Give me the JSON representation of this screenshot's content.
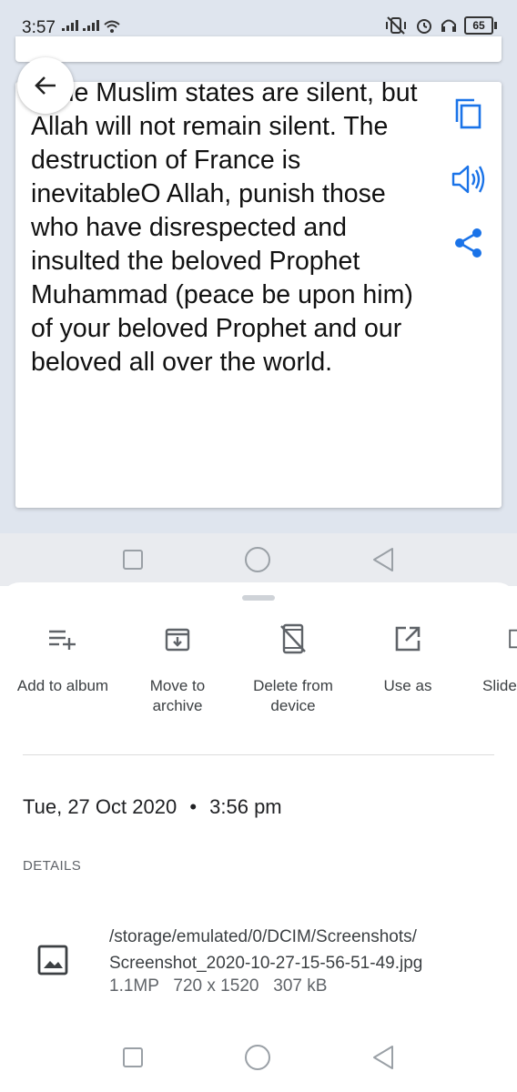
{
  "status_bar": {
    "time": "3:57",
    "battery": "65"
  },
  "translation": {
    "text": "If the Muslim states are silent, but Allah will not remain silent. The destruction of France is inevitableO Allah, punish those who have disrespected and insulted the beloved Prophet Muhammad (peace be upon him) of your beloved Prophet and our beloved all over the world.",
    "icons": [
      "copy-icon",
      "speaker-icon",
      "share-icon"
    ]
  },
  "sheet": {
    "actions": [
      {
        "label": "Add to album",
        "icon": "playlist-add-icon"
      },
      {
        "label": "Move to archive",
        "icon": "archive-icon"
      },
      {
        "label": "Delete from device",
        "icon": "delete-device-icon"
      },
      {
        "label": "Use as",
        "icon": "open-external-icon"
      },
      {
        "label": "Slide",
        "icon": "slideshow-icon"
      }
    ],
    "date": "Tue, 27 Oct 2020",
    "time": "3:56 pm",
    "details_label": "DETAILS",
    "file": {
      "path_line1": "/storage/emulated/0/DCIM/Screenshots/",
      "path_line2": "Screenshot_2020-10-27-15-56-51-49.jpg",
      "megapixels": "1.1MP",
      "resolution": "720 x 1520",
      "size": "307 kB"
    }
  },
  "colors": {
    "accent": "#1a73e8",
    "background_top": "#dfe5ee"
  }
}
